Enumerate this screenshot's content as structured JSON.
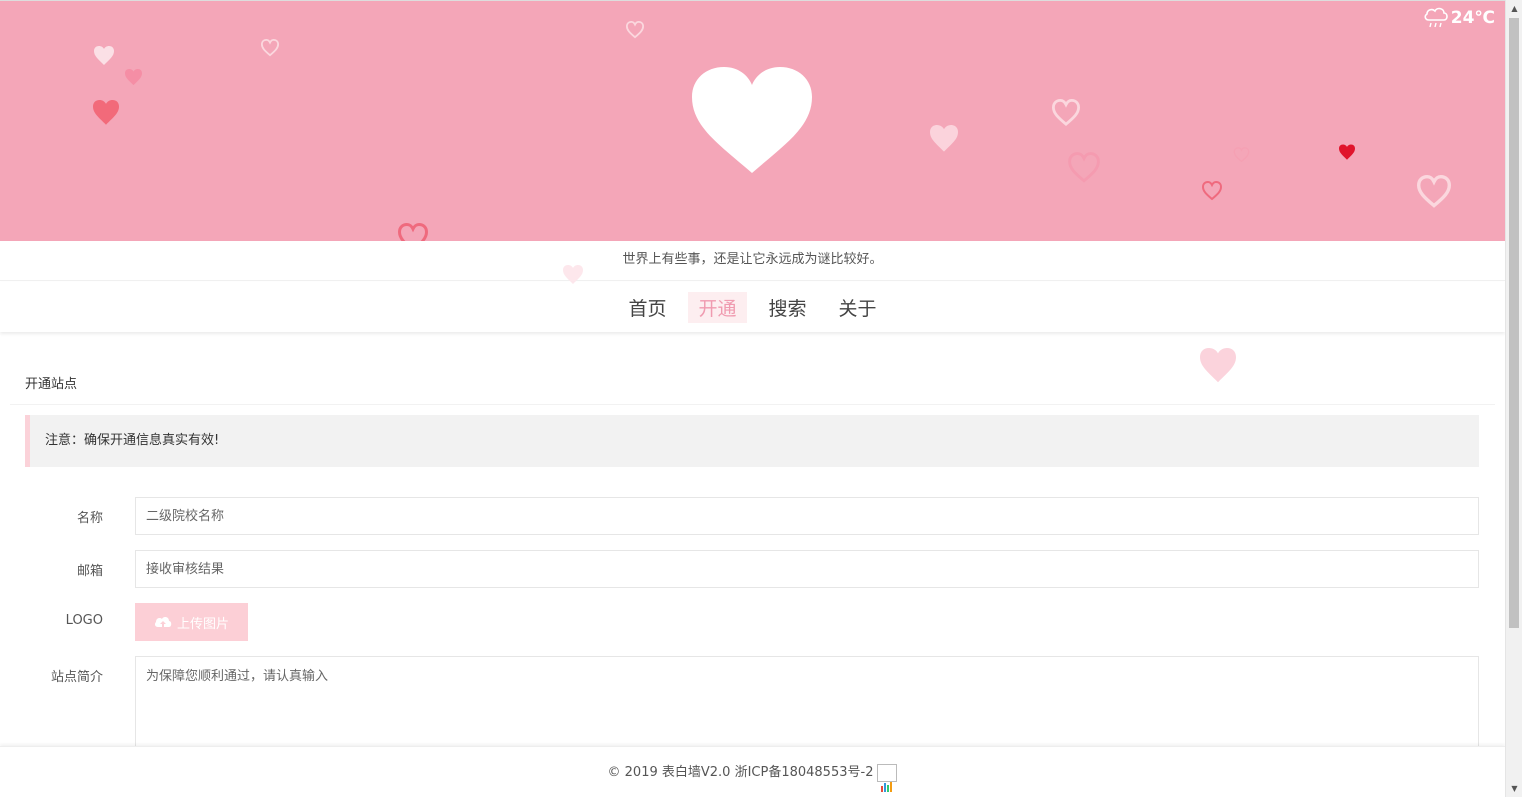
{
  "header": {
    "weather_temp": "24℃",
    "weather_icon": "rain-cloud-icon",
    "slogan": "世界上有些事，还是让它永远成为谜比较好。"
  },
  "nav": {
    "items": [
      {
        "label": "首页",
        "active": false
      },
      {
        "label": "开通",
        "active": true
      },
      {
        "label": "搜索",
        "active": false
      },
      {
        "label": "关于",
        "active": false
      }
    ]
  },
  "main": {
    "section_title": "开通站点",
    "notice": "注意：确保开通信息真实有效!",
    "form": {
      "name_label": "名称",
      "name_placeholder": "二级院校名称",
      "email_label": "邮箱",
      "email_placeholder": "接收审核结果",
      "logo_label": "LOGO",
      "upload_label": "上传图片",
      "intro_label": "站点简介",
      "intro_placeholder": "为保障您顺利通过，请认真输入"
    }
  },
  "footer": {
    "text": "© 2019 表白墙V2.0   浙ICP备18048553号-2"
  },
  "colors": {
    "banner": "#f4a6b8",
    "accent": "#f09bb0",
    "upload_button": "#fccfd6"
  }
}
